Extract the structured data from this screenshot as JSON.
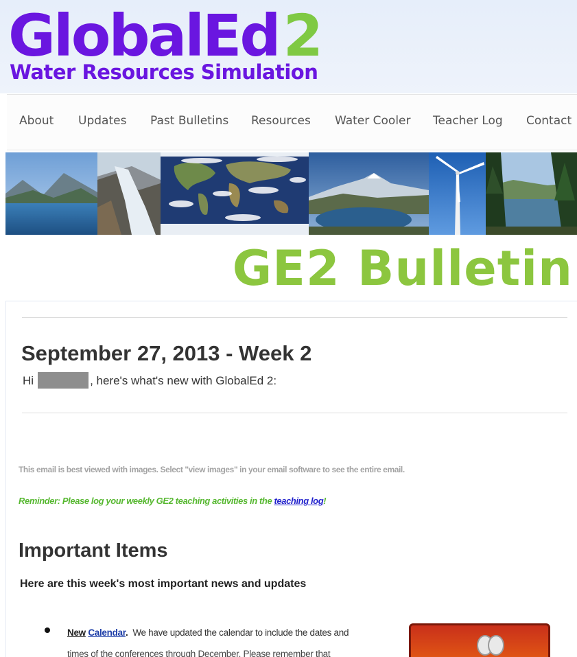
{
  "header": {
    "logo_main": "GlobalEd",
    "logo_number": "2",
    "logo_subtitle": "Water Resources Simulation"
  },
  "nav": {
    "items": [
      {
        "label": "About"
      },
      {
        "label": "Updates"
      },
      {
        "label": "Past Bulletins"
      },
      {
        "label": "Resources"
      },
      {
        "label": "Water Cooler"
      },
      {
        "label": "Teacher Log"
      },
      {
        "label": "Contact"
      }
    ]
  },
  "banner": {
    "photos": [
      "lake-mountains",
      "glacier-waterfall",
      "world-map-satellite",
      "mountain-lake",
      "wind-turbine",
      "forest-lake"
    ]
  },
  "bulletin": {
    "title": "GE2 Bulletin",
    "title_color": "#8cc63f"
  },
  "issue": {
    "title": "September 27, 2013 - Week 2",
    "greeting_prefix": "Hi",
    "greeting_suffix": ", here's what's new with GlobalEd 2:"
  },
  "notices": {
    "view_images": "This email is best viewed with images. Select \"view images\" in your email software to see the entire email.",
    "reminder_text": "Reminder: Please log your weekly GE2 teaching activities in the ",
    "reminder_link": "teaching log",
    "reminder_end": "!"
  },
  "important": {
    "title": "Important Items",
    "subtitle": "Here are this week's most important news and updates",
    "items": [
      {
        "lead_new": "New",
        "link": "Calendar",
        "lead_period": ".",
        "text": "We have updated the calendar to include the dates and",
        "text_cont": "times of the conferences through December. Please remember that"
      }
    ]
  },
  "colors": {
    "logo_purple": "#6a16e0",
    "logo_green": "#7fc943",
    "reminder_green": "#57b831",
    "link_blue": "#2222cc"
  }
}
